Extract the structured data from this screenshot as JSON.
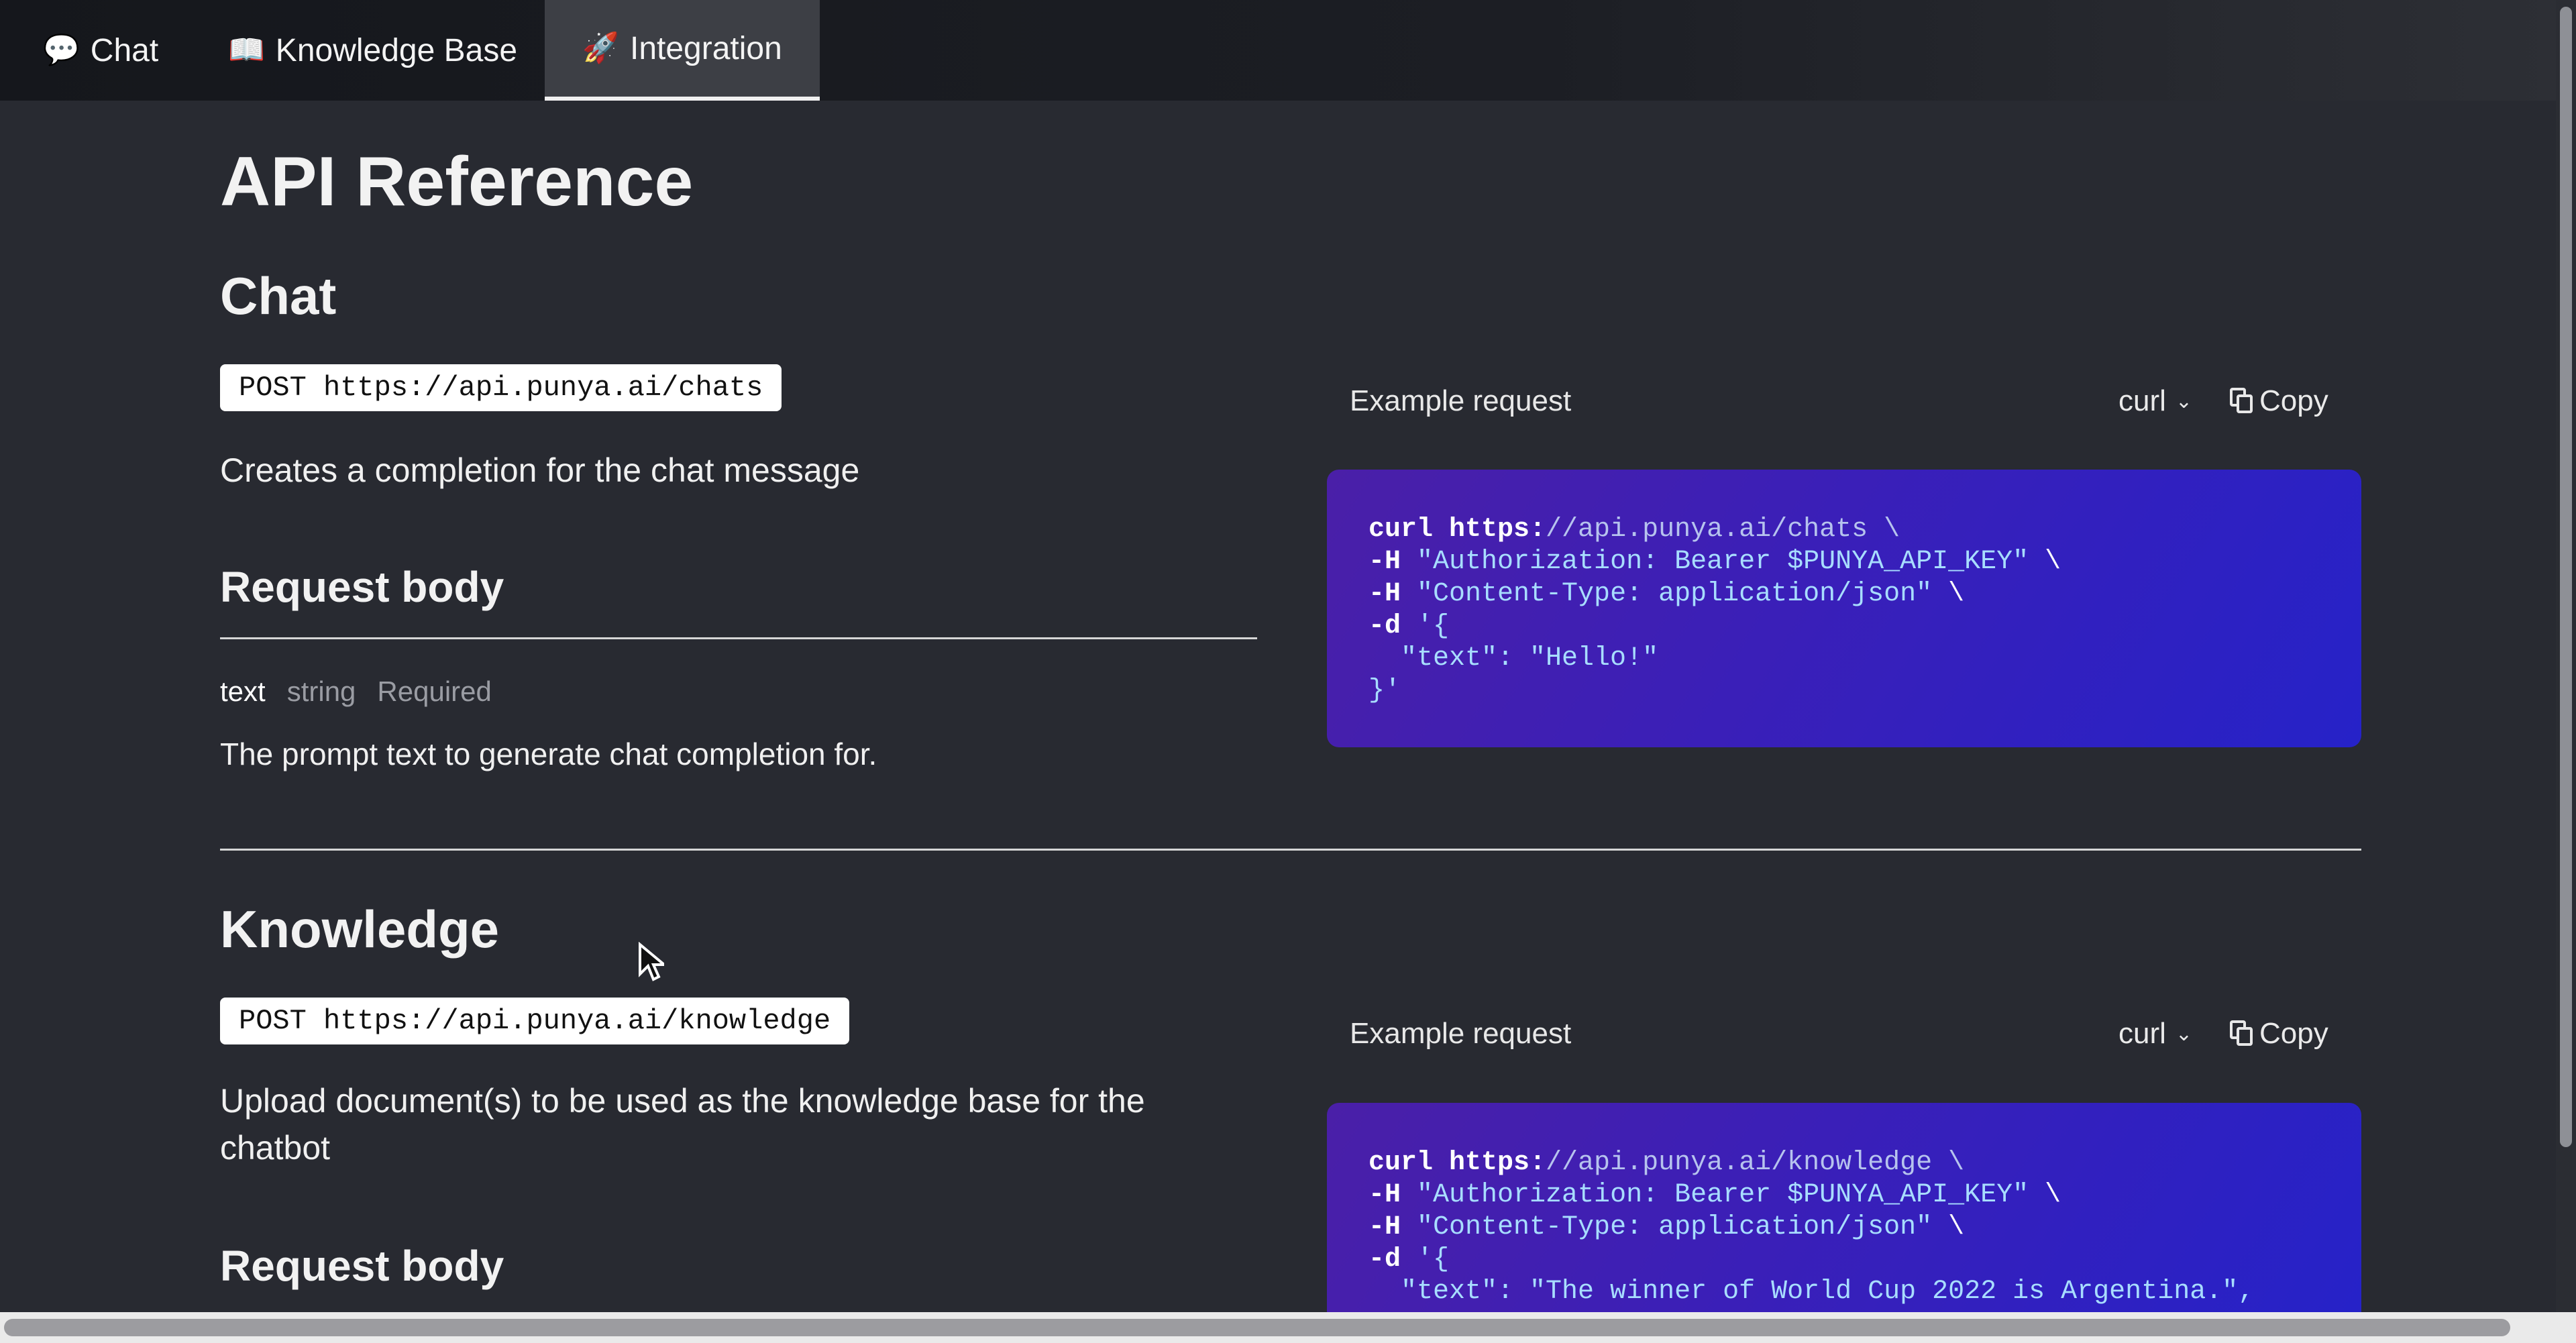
{
  "tabs": [
    {
      "icon": "💬",
      "label": "Chat"
    },
    {
      "icon": "📖",
      "label": "Knowledge Base"
    },
    {
      "icon": "🚀",
      "label": "Integration"
    }
  ],
  "page": {
    "title": "API Reference"
  },
  "chat": {
    "heading": "Chat",
    "endpoint": "POST https://api.punya.ai/chats",
    "description": "Creates a completion for the chat message",
    "request_body_heading": "Request body",
    "field": {
      "name": "text",
      "type": "string",
      "required": "Required",
      "description": "The prompt text to generate chat completion for."
    },
    "example": {
      "label": "Example request",
      "language": "curl",
      "copy_label": "Copy",
      "lines": [
        [
          [
            "c-kw",
            "curl https:"
          ],
          [
            "c-url",
            "//api.punya.ai/chats \\"
          ]
        ],
        [
          [
            "c-kw",
            "-H "
          ],
          [
            "c-str",
            "\"Authorization: Bearer $PUNYA_API_KEY\""
          ],
          [
            "c-plain",
            " \\"
          ]
        ],
        [
          [
            "c-kw",
            "-H "
          ],
          [
            "c-str",
            "\"Content-Type: application/json\""
          ],
          [
            "c-plain",
            " \\"
          ]
        ],
        [
          [
            "c-kw",
            "-d "
          ],
          [
            "c-str",
            "'{"
          ]
        ],
        [
          [
            "c-str",
            "  \"text\": \"Hello!\""
          ]
        ],
        [
          [
            "c-str",
            "}'"
          ]
        ]
      ]
    }
  },
  "knowledge": {
    "heading": "Knowledge",
    "endpoint": "POST https://api.punya.ai/knowledge",
    "description_line1": "Upload document(s) to be used as the knowledge base for the",
    "description_line2": "chatbot",
    "request_body_heading": "Request body",
    "example": {
      "label": "Example request",
      "language": "curl",
      "copy_label": "Copy",
      "lines": [
        [
          [
            "c-kw",
            "curl https:"
          ],
          [
            "c-url",
            "//api.punya.ai/knowledge \\"
          ]
        ],
        [
          [
            "c-kw",
            "-H "
          ],
          [
            "c-str",
            "\"Authorization: Bearer $PUNYA_API_KEY\""
          ],
          [
            "c-plain",
            " \\"
          ]
        ],
        [
          [
            "c-kw",
            "-H "
          ],
          [
            "c-str",
            "\"Content-Type: application/json\""
          ],
          [
            "c-plain",
            " \\"
          ]
        ],
        [
          [
            "c-kw",
            "-d "
          ],
          [
            "c-str",
            "'{"
          ]
        ],
        [
          [
            "c-str",
            "  \"text\": \"The winner of World Cup 2022 is Argentina.\","
          ]
        ]
      ]
    }
  }
}
